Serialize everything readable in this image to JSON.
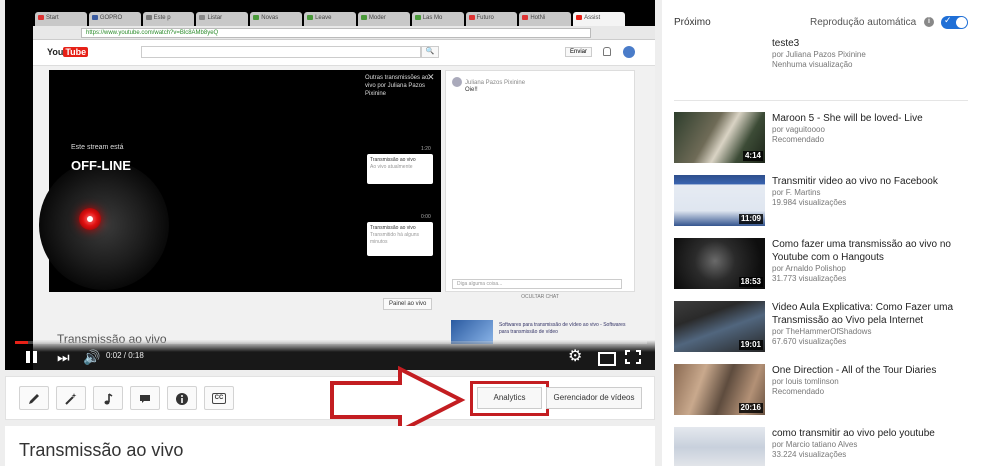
{
  "browser": {
    "tabs": [
      "Start",
      "GOPRO",
      "Este p",
      "Listar",
      "Novas",
      "Leave",
      "Moder",
      "Las Mo",
      "Futuro",
      "HotNi",
      "Assist"
    ],
    "url": "https://www.youtube.com/watch?v=Blc8AMb8yeQ"
  },
  "inner_page": {
    "logo": "You",
    "logo_red": "Tube",
    "search_button": "🔍",
    "upload_label": "Enviar",
    "offline_small": "Este stream está",
    "offline_big": "OFF-LINE",
    "panel_heading": "Outras transmissões ao vivo por Juliana Pazos Pixinine",
    "panel_close": "✕",
    "card1_time": "1:20",
    "card1_title": "Transmissão ao vivo",
    "card1_sub": "Ao vivo atualmente",
    "card2_time": "0:00",
    "card2_title": "Transmissão ao vivo",
    "card2_sub": "Transmitido há alguns minutos",
    "chat_user": "Juliana Pazos Pixinine",
    "chat_text": "Oie!!",
    "chat_placeholder": "Diga alguma coisa...",
    "chat_hide": "OCULTAR CHAT",
    "panel_button": "Painel ao vivo",
    "inner_title": "Transmissão ao vivo",
    "reco_text": "Softwares para transmissão de vídeo ao vivo - Softwares para transmissão de vídeo"
  },
  "player": {
    "progress_fraction": 0.02,
    "time_current": "0:02",
    "time_sep": " / ",
    "time_total": "0:18",
    "gear_glyph": "⚙",
    "next_glyph": "⏭",
    "vol_glyph": "🔊"
  },
  "toolbar": {
    "cc_label": "CC",
    "analytics_label": "Analytics",
    "manager_label": "Gerenciador de vídeos"
  },
  "video": {
    "title": "Transmissão ao vivo"
  },
  "sidebar": {
    "next_label": "Próximo",
    "autoplay_label": "Reprodução automática",
    "info_glyph": "i",
    "toggle_check": "✓",
    "first_item": {
      "title": "teste3",
      "channel": "por Juliana Pazos Pixinine",
      "meta": "Nenhuma visualização"
    },
    "items": [
      {
        "title": "Maroon 5 - She will be loved- Live",
        "channel": "por vaguitoooo",
        "meta": "Recomendado",
        "duration": "4:14"
      },
      {
        "title": "Transmitir video ao vivo no Facebook",
        "channel": "por F. Martins",
        "meta": "19.984 visualizações",
        "duration": "11:09"
      },
      {
        "title": "Como fazer uma transmissão ao vivo no Youtube com o Hangouts",
        "channel": "por Arnaldo Polishop",
        "meta": "31.773 visualizações",
        "duration": "18:53"
      },
      {
        "title": "Video Aula Explicativa: Como Fazer uma Transmissão ao Vivo pela Internet",
        "channel": "por TheHammerOfShadows",
        "meta": "67.670 visualizações",
        "duration": "19:01"
      },
      {
        "title": "One Direction - All of the Tour Diaries",
        "channel": "por louis tomlinson",
        "meta": "Recomendado",
        "duration": "20:16"
      },
      {
        "title": "como transmitir ao vivo pelo youtube",
        "channel": "por Marcio tatiano Alves",
        "meta": "33.224 visualizações",
        "duration": ""
      }
    ]
  },
  "colors": {
    "accent_red": "#e62117",
    "highlight": "#c31d21",
    "toggle_blue": "#1f6fd6"
  }
}
